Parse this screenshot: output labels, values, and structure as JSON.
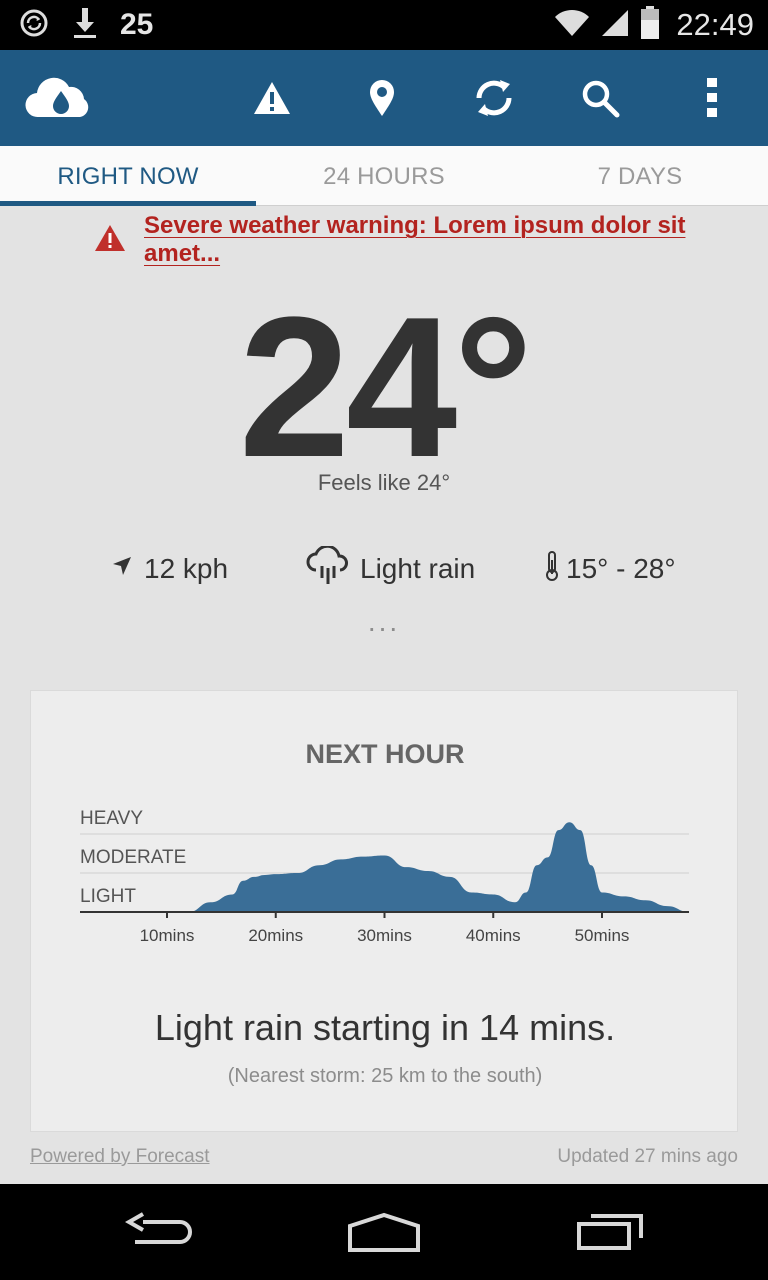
{
  "status_bar": {
    "notification_count": "25",
    "time": "22:49"
  },
  "tabs": [
    {
      "label": "RIGHT NOW",
      "active": true
    },
    {
      "label": "24 HOURS",
      "active": false
    },
    {
      "label": "7 DAYS",
      "active": false
    }
  ],
  "warning": {
    "text": "Severe weather warning: Lorem ipsum dolor sit amet..."
  },
  "current": {
    "temperature": "24°",
    "feels_like": "Feels like 24°",
    "wind": "12 kph",
    "condition": "Light rain",
    "range": "15° - 28°",
    "more": "..."
  },
  "next_hour": {
    "title": "NEXT HOUR",
    "summary": "Light rain starting in 14 mins.",
    "nearest_storm": "(Nearest storm: 25 km to the south)"
  },
  "chart_data": {
    "type": "area",
    "title": "NEXT HOUR",
    "y_levels": [
      "HEAVY",
      "MODERATE",
      "LIGHT"
    ],
    "ylim": [
      0,
      3
    ],
    "xlim": [
      2,
      58
    ],
    "x_ticks": [
      10,
      20,
      30,
      40,
      50
    ],
    "x_tick_labels": [
      "10mins",
      "20mins",
      "30mins",
      "40mins",
      "50mins"
    ],
    "colors": {
      "fill": "#3a6e97",
      "axis": "#333333",
      "grid": "#cfcfcf"
    },
    "series": [
      {
        "x": [
          2,
          12,
          14,
          16,
          17,
          18,
          19,
          20,
          22,
          24,
          26,
          28,
          30,
          32,
          34,
          36,
          38,
          40,
          42,
          43,
          44,
          45,
          46,
          47,
          48,
          49,
          50,
          52,
          54,
          56,
          58
        ],
        "y": [
          0,
          0,
          0.25,
          0.45,
          0.8,
          0.9,
          0.95,
          0.97,
          1.0,
          1.2,
          1.35,
          1.42,
          1.45,
          1.15,
          1.05,
          0.9,
          0.5,
          0.45,
          0.25,
          0.5,
          1.2,
          1.4,
          2.1,
          2.3,
          2.1,
          1.2,
          0.5,
          0.4,
          0.3,
          0.15,
          0
        ]
      }
    ]
  },
  "footer": {
    "powered_by": "Powered by Forecast",
    "updated": "Updated 27 mins ago"
  },
  "icons": {
    "app_logo": "cloud-drop-icon",
    "warning": "warning-icon",
    "location": "location-icon",
    "refresh": "refresh-icon",
    "search": "search-icon",
    "menu": "overflow-menu-icon"
  }
}
